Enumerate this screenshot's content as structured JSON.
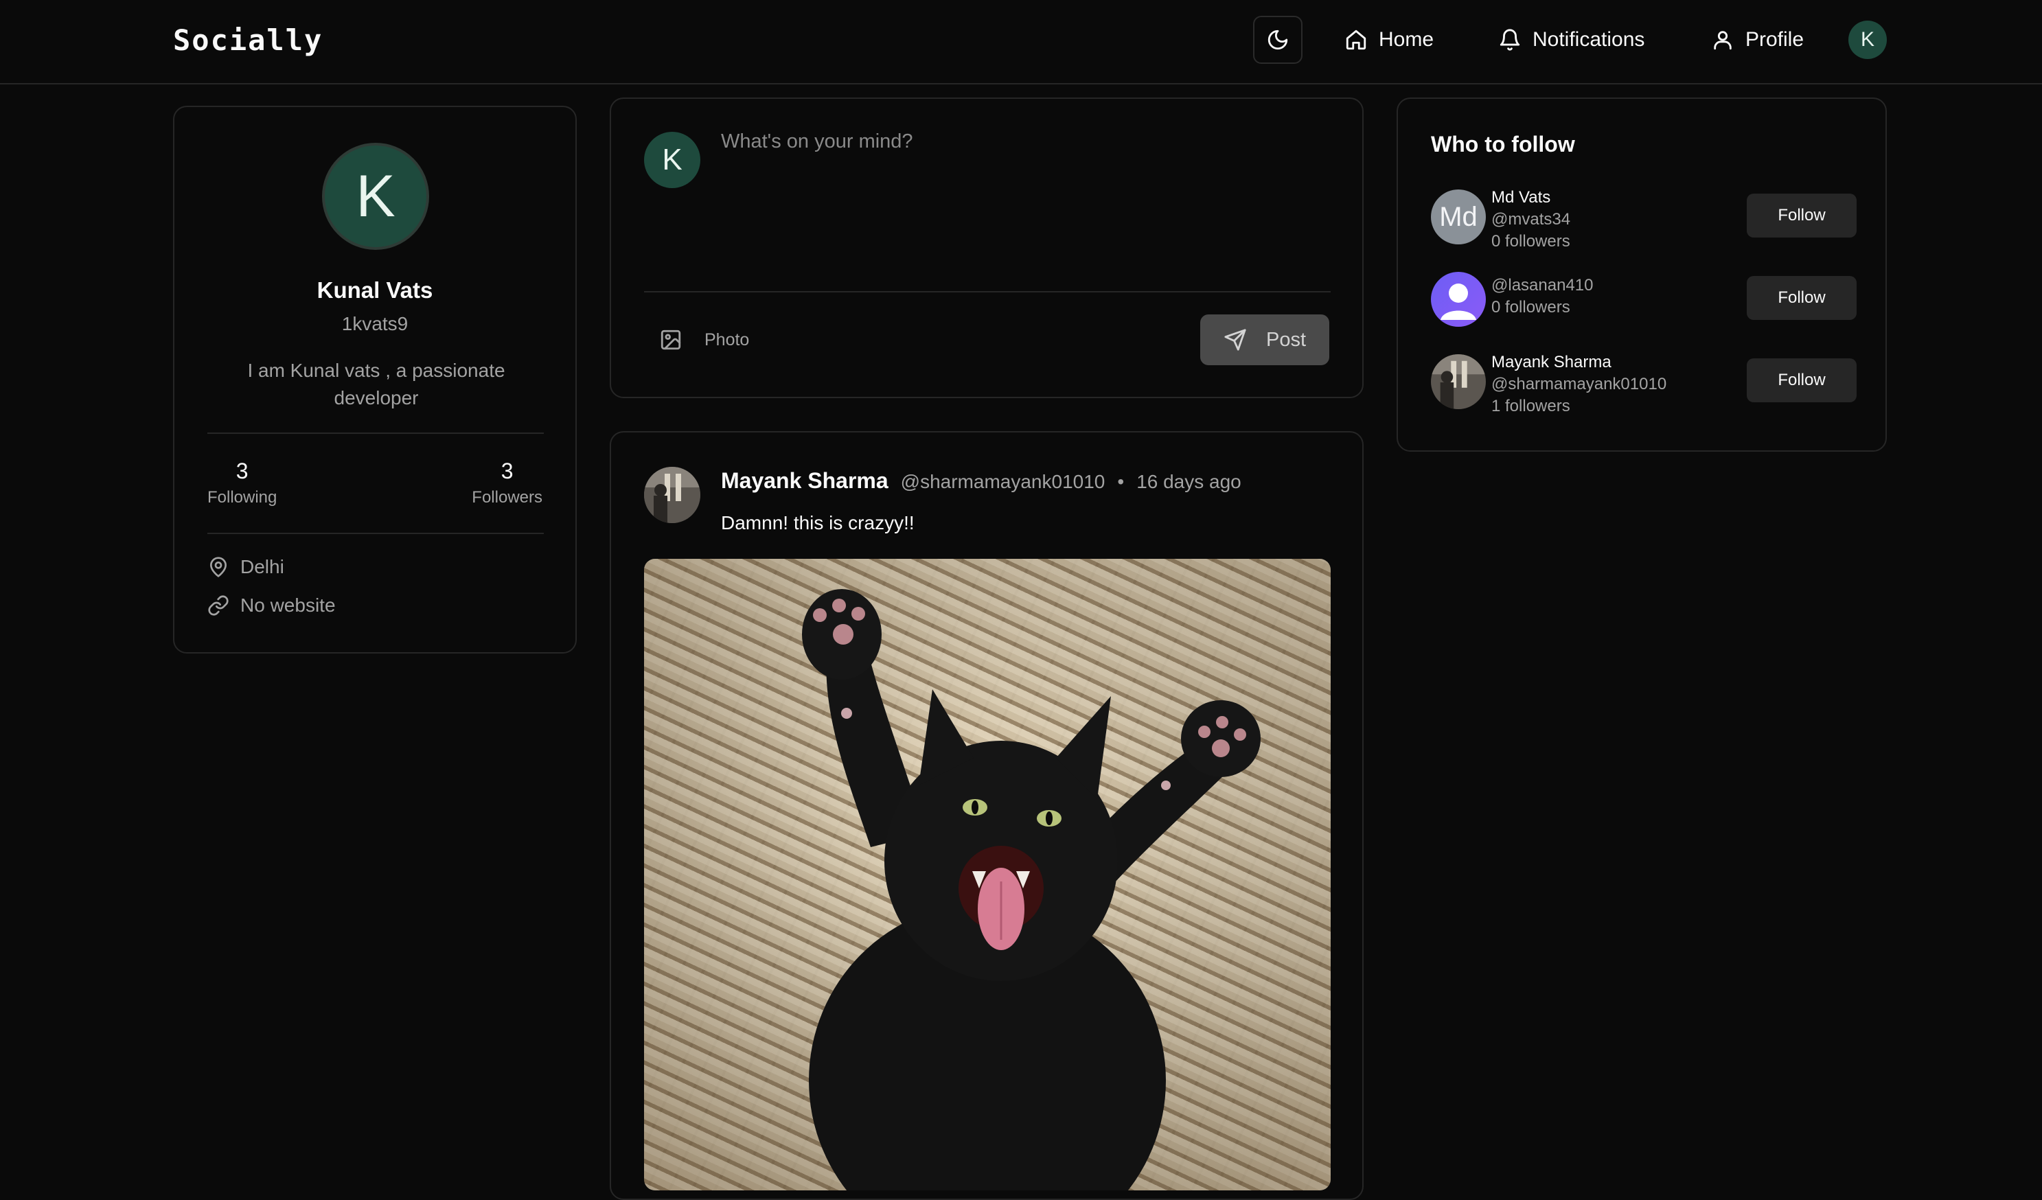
{
  "header": {
    "brand": "Socially",
    "nav": {
      "home": "Home",
      "notifications": "Notifications",
      "profile": "Profile"
    },
    "avatar_initial": "K"
  },
  "profile": {
    "avatar_initial": "K",
    "name": "Kunal Vats",
    "username": "1kvats9",
    "bio": "I am Kunal vats , a passionate developer",
    "following_count": "3",
    "following_label": "Following",
    "followers_count": "3",
    "followers_label": "Followers",
    "location": "Delhi",
    "website": "No website"
  },
  "composer": {
    "avatar_initial": "K",
    "placeholder": "What's on your mind?",
    "photo_label": "Photo",
    "post_label": "Post"
  },
  "post": {
    "author_name": "Mayank Sharma",
    "author_handle": "@sharmamayank01010",
    "separator": "•",
    "time": "16 days ago",
    "text": "Damnn! this is crazyy!!"
  },
  "who_to_follow": {
    "title": "Who to follow",
    "users": [
      {
        "avatar_text": "Md",
        "name": "Md Vats",
        "handle": "@mvats34",
        "followers": "0 followers",
        "button": "Follow"
      },
      {
        "avatar_text": "",
        "name": "",
        "handle": "@lasanan410",
        "followers": "0 followers",
        "button": "Follow"
      },
      {
        "avatar_text": "",
        "name": "Mayank Sharma",
        "handle": "@sharmamayank01010",
        "followers": "1 followers",
        "button": "Follow"
      }
    ]
  },
  "colors": {
    "background": "#0a0a0a",
    "border": "#262626",
    "avatar_green": "#1e4a3d",
    "muted_text": "#a3a3a3",
    "button_bg": "#262626"
  }
}
